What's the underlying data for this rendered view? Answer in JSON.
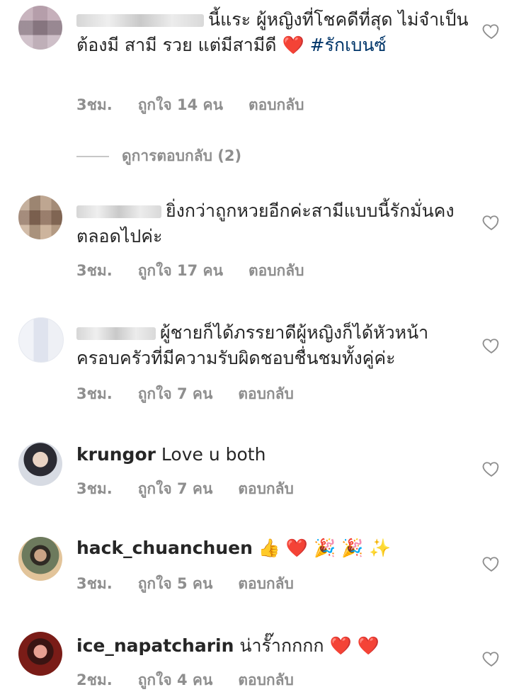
{
  "comments": [
    {
      "username_blurred": true,
      "text": "นี้แระ ผู้หญิงที่โชคดีที่สุด ไม่จำเป็นต้องมี สามี รวย แต่มีสามีดี ",
      "emoji": "❤️",
      "hashtag": "#รักเบนซ์",
      "time": "3ชม.",
      "likes": "ถูกใจ 14 คน",
      "reply": "ตอบกลับ",
      "view_replies": "ดูการตอบกลับ (2)"
    },
    {
      "username_blurred": true,
      "text": "ยิ่งกว่าถูกหวยอีกค่ะสามีแบบนี้รักมั่นคงตลอดไปค่ะ",
      "time": "3ชม.",
      "likes": "ถูกใจ 17 คน",
      "reply": "ตอบกลับ"
    },
    {
      "username_blurred": true,
      "text": "ผู้ชายก็ได้ภรรยาดีผู้หญิงก็ได้หัวหน้าครอบครัวที่มีความรับผิดชอบชื่นชมทั้งคู่ค่ะ",
      "time": "3ชม.",
      "likes": "ถูกใจ 7 คน",
      "reply": "ตอบกลับ"
    },
    {
      "username": "krungor",
      "text": "Love u both",
      "time": "3ชม.",
      "likes": "ถูกใจ 7 คน",
      "reply": "ตอบกลับ"
    },
    {
      "username": "hack_chuanchuen",
      "text": "👍 ❤️ 🎉 🎉 ✨",
      "time": "3ชม.",
      "likes": "ถูกใจ 5 คน",
      "reply": "ตอบกลับ"
    },
    {
      "username": "ice_napatcharin",
      "text": "น่ารั๊ากกกก ❤️ ❤️",
      "time": "2ชม.",
      "likes": "ถูกใจ 4 คน",
      "reply": "ตอบกลับ"
    }
  ],
  "icons": {
    "like": "heart-outline-icon"
  },
  "colors": {
    "meta": "#8e8e8e",
    "hashtag": "#003569",
    "heart": "#e0192a"
  }
}
